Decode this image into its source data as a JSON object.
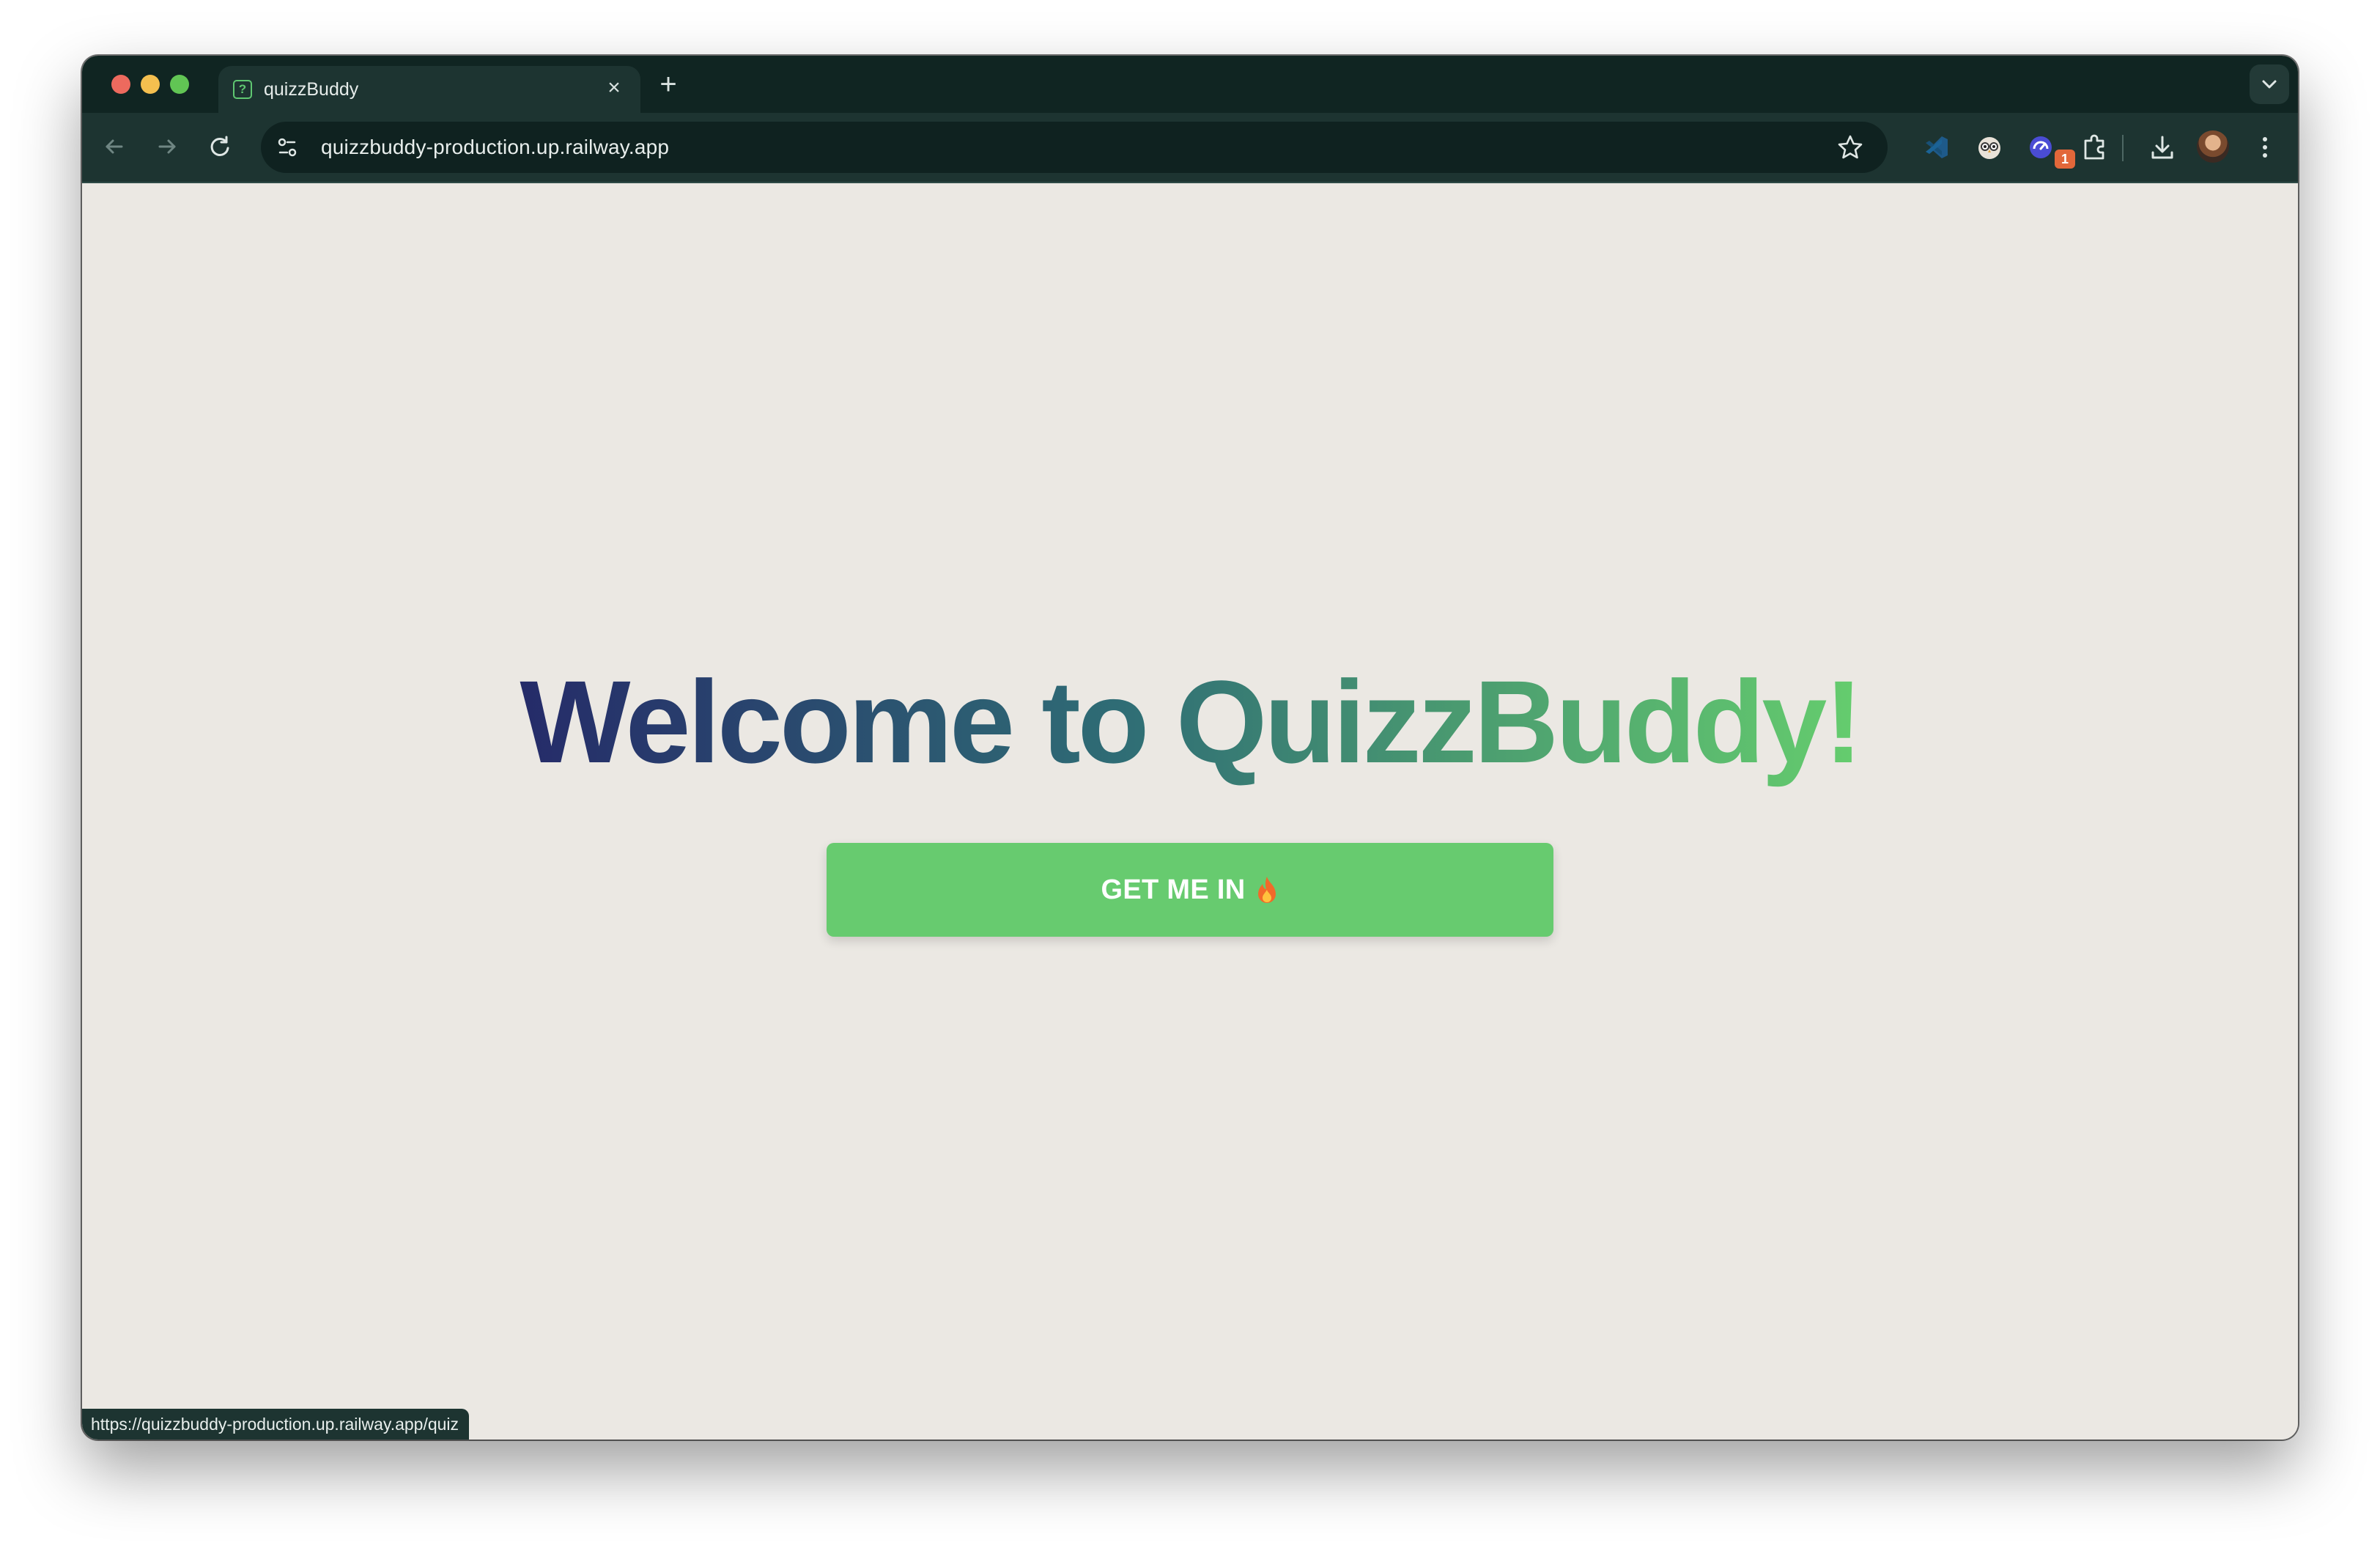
{
  "browser": {
    "tab": {
      "title": "quizzBuddy",
      "favicon": "question-mark-icon"
    },
    "address_bar": {
      "url": "quizzbuddy-production.up.railway.app"
    },
    "extensions": {
      "badge_count": "1"
    },
    "status_bar": {
      "link_url": "https://quizzbuddy-production.up.railway.app/quiz"
    }
  },
  "page": {
    "heading": "Welcome to QuizzBuddy!",
    "cta_label": "GET ME IN",
    "cta_icon": "fire-icon"
  },
  "colors": {
    "page_background": "#ebe8e3",
    "heading_gradient_start": "#252b69",
    "heading_gradient_end": "#65cd6e",
    "button_background": "#67cb6f",
    "browser_chrome": "#102522"
  }
}
